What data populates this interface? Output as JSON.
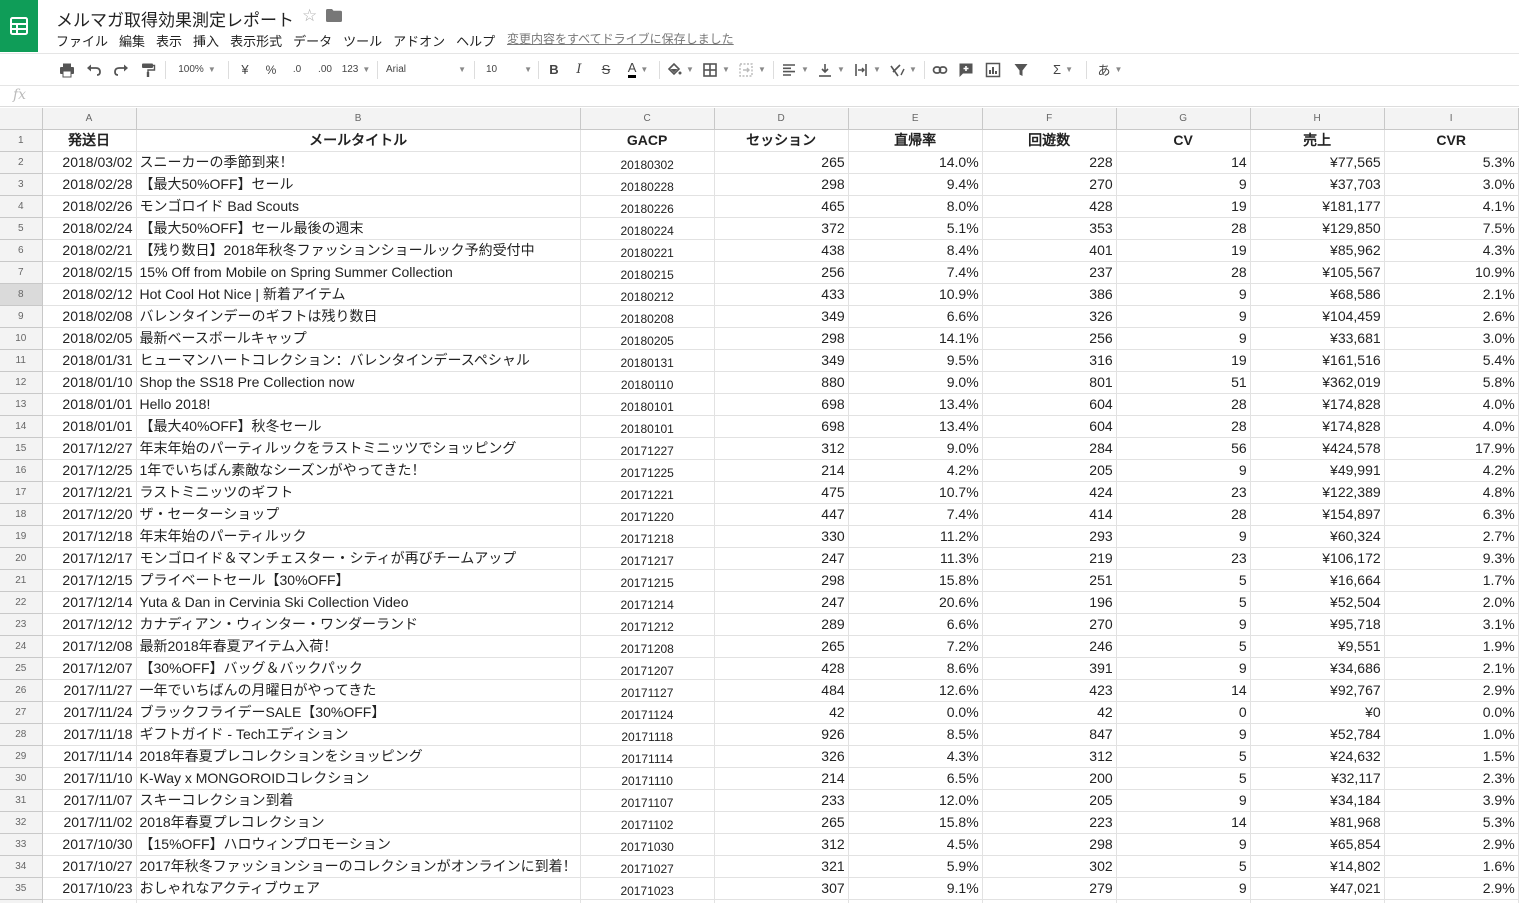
{
  "doc": {
    "title": "メルマガ取得効果測定レポート",
    "save_status": "変更内容をすべてドライブに保存しました"
  },
  "menu": [
    "ファイル",
    "編集",
    "表示",
    "挿入",
    "表示形式",
    "データ",
    "ツール",
    "アドオン",
    "ヘルプ"
  ],
  "toolbar": {
    "zoom": "100%",
    "currency": "¥",
    "percent": "%",
    "decrease_decimal": ".0",
    "increase_decimal": ".00",
    "more_formats": "123",
    "font": "Arial",
    "font_size": "10",
    "bold": "B",
    "italic": "I",
    "strikethrough": "S",
    "text_color": "A",
    "input_tool": "あ"
  },
  "formula_bar": {
    "fx": "fx",
    "value": ""
  },
  "columns": [
    "A",
    "B",
    "C",
    "D",
    "E",
    "F",
    "G",
    "H",
    "I"
  ],
  "headers": [
    "発送日",
    "メールタイトル",
    "GACP",
    "セッション",
    "直帰率",
    "回遊数",
    "CV",
    "売上",
    "CVR"
  ],
  "active_row": 8,
  "rows": [
    [
      "2018/03/02",
      "スニーカーの季節到来！",
      "20180302",
      "265",
      "14.0%",
      "228",
      "14",
      "¥77,565",
      "5.3%"
    ],
    [
      "2018/02/28",
      "【最大50%OFF】セール",
      "20180228",
      "298",
      "9.4%",
      "270",
      "9",
      "¥37,703",
      "3.0%"
    ],
    [
      "2018/02/26",
      "モンゴロイド Bad Scouts",
      "20180226",
      "465",
      "8.0%",
      "428",
      "19",
      "¥181,177",
      "4.1%"
    ],
    [
      "2018/02/24",
      "【最大50%OFF】セール最後の週末",
      "20180224",
      "372",
      "5.1%",
      "353",
      "28",
      "¥129,850",
      "7.5%"
    ],
    [
      "2018/02/21",
      "【残り数日】2018年秋冬ファッションショールック予約受付中",
      "20180221",
      "438",
      "8.4%",
      "401",
      "19",
      "¥85,962",
      "4.3%"
    ],
    [
      "2018/02/15",
      "15% Off from Mobile on Spring Summer Collection",
      "20180215",
      "256",
      "7.4%",
      "237",
      "28",
      "¥105,567",
      "10.9%"
    ],
    [
      "2018/02/12",
      "Hot Cool Hot Nice | 新着アイテム",
      "20180212",
      "433",
      "10.9%",
      "386",
      "9",
      "¥68,586",
      "2.1%"
    ],
    [
      "2018/02/08",
      "バレンタインデーのギフトは残り数日",
      "20180208",
      "349",
      "6.6%",
      "326",
      "9",
      "¥104,459",
      "2.6%"
    ],
    [
      "2018/02/05",
      "最新ベースボールキャップ",
      "20180205",
      "298",
      "14.1%",
      "256",
      "9",
      "¥33,681",
      "3.0%"
    ],
    [
      "2018/01/31",
      "ヒューマンハートコレクション：バレンタインデースペシャル",
      "20180131",
      "349",
      "9.5%",
      "316",
      "19",
      "¥161,516",
      "5.4%"
    ],
    [
      "2018/01/10",
      "Shop the SS18 Pre Collection now",
      "20180110",
      "880",
      "9.0%",
      "801",
      "51",
      "¥362,019",
      "5.8%"
    ],
    [
      "2018/01/01",
      "Hello 2018!",
      "20180101",
      "698",
      "13.4%",
      "604",
      "28",
      "¥174,828",
      "4.0%"
    ],
    [
      "2018/01/01",
      "【最大40%OFF】秋冬セール",
      "20180101",
      "698",
      "13.4%",
      "604",
      "28",
      "¥174,828",
      "4.0%"
    ],
    [
      "2017/12/27",
      "年末年始のパーティルックをラストミニッツでショッピング",
      "20171227",
      "312",
      "9.0%",
      "284",
      "56",
      "¥424,578",
      "17.9%"
    ],
    [
      "2017/12/25",
      "1年でいちばん素敵なシーズンがやってきた！",
      "20171225",
      "214",
      "4.2%",
      "205",
      "9",
      "¥49,991",
      "4.2%"
    ],
    [
      "2017/12/21",
      "ラストミニッツのギフト",
      "20171221",
      "475",
      "10.7%",
      "424",
      "23",
      "¥122,389",
      "4.8%"
    ],
    [
      "2017/12/20",
      "ザ・セーターショップ",
      "20171220",
      "447",
      "7.4%",
      "414",
      "28",
      "¥154,897",
      "6.3%"
    ],
    [
      "2017/12/18",
      "年末年始のパーティルック",
      "20171218",
      "330",
      "11.2%",
      "293",
      "9",
      "¥60,324",
      "2.7%"
    ],
    [
      "2017/12/17",
      "モンゴロイド＆マンチェスター・シティが再びチームアップ",
      "20171217",
      "247",
      "11.3%",
      "219",
      "23",
      "¥106,172",
      "9.3%"
    ],
    [
      "2017/12/15",
      "プライベートセール【30%OFF】",
      "20171215",
      "298",
      "15.8%",
      "251",
      "5",
      "¥16,664",
      "1.7%"
    ],
    [
      "2017/12/14",
      "Yuta & Dan in Cervinia Ski Collection Video",
      "20171214",
      "247",
      "20.6%",
      "196",
      "5",
      "¥52,504",
      "2.0%"
    ],
    [
      "2017/12/12",
      "カナディアン・ウィンター・ワンダーランド",
      "20171212",
      "289",
      "6.6%",
      "270",
      "9",
      "¥95,718",
      "3.1%"
    ],
    [
      "2017/12/08",
      "最新2018年春夏アイテム入荷！",
      "20171208",
      "265",
      "7.2%",
      "246",
      "5",
      "¥9,551",
      "1.9%"
    ],
    [
      "2017/12/07",
      "【30%OFF】バッグ＆バックパック",
      "20171207",
      "428",
      "8.6%",
      "391",
      "9",
      "¥34,686",
      "2.1%"
    ],
    [
      "2017/11/27",
      "一年でいちばんの月曜日がやってきた",
      "20171127",
      "484",
      "12.6%",
      "423",
      "14",
      "¥92,767",
      "2.9%"
    ],
    [
      "2017/11/24",
      "ブラックフライデーSALE【30%OFF】",
      "20171124",
      "42",
      "0.0%",
      "42",
      "0",
      "¥0",
      "0.0%"
    ],
    [
      "2017/11/18",
      "ギフトガイド - Techエディション",
      "20171118",
      "926",
      "8.5%",
      "847",
      "9",
      "¥52,784",
      "1.0%"
    ],
    [
      "2017/11/14",
      "2018年春夏プレコレクションをショッピング",
      "20171114",
      "326",
      "4.3%",
      "312",
      "5",
      "¥24,632",
      "1.5%"
    ],
    [
      "2017/11/10",
      "K-Way x MONGOROIDコレクション",
      "20171110",
      "214",
      "6.5%",
      "200",
      "5",
      "¥32,117",
      "2.3%"
    ],
    [
      "2017/11/07",
      "スキーコレクション到着",
      "20171107",
      "233",
      "12.0%",
      "205",
      "9",
      "¥34,184",
      "3.9%"
    ],
    [
      "2017/11/02",
      "2018年春夏プレコレクション",
      "20171102",
      "265",
      "15.8%",
      "223",
      "14",
      "¥81,968",
      "5.3%"
    ],
    [
      "2017/10/30",
      "【15%OFF】ハロウィンプロモーション",
      "20171030",
      "312",
      "4.5%",
      "298",
      "9",
      "¥65,854",
      "2.9%"
    ],
    [
      "2017/10/27",
      "2017年秋冬ファッションショーのコレクションがオンラインに到着！",
      "20171027",
      "321",
      "5.9%",
      "302",
      "5",
      "¥14,802",
      "1.6%"
    ],
    [
      "2017/10/23",
      "おしゃれなアクティブウェア",
      "20171023",
      "307",
      "9.1%",
      "279",
      "9",
      "¥47,021",
      "2.9%"
    ],
    [
      "",
      "",
      "",
      "",
      "",
      "",
      "",
      "",
      ""
    ]
  ]
}
